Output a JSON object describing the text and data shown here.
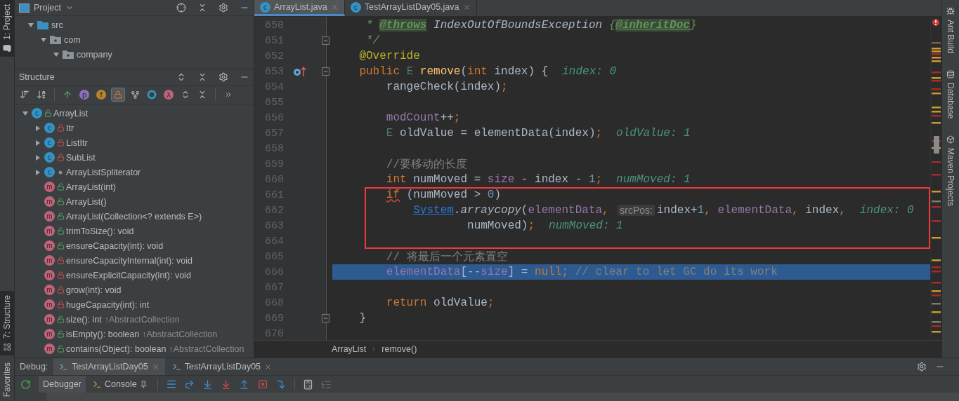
{
  "left_strip": {
    "top": [
      {
        "label": "1: Project",
        "kind": "project",
        "selected": true
      },
      {
        "label": "7: Structure",
        "kind": "structure",
        "selected": true
      }
    ],
    "bottom": [
      {
        "label": "Favorites",
        "selected": false
      }
    ]
  },
  "project": {
    "title": "Project",
    "tree": [
      {
        "label": "src",
        "kind": "source-folder",
        "expanded": true,
        "children": [
          {
            "label": "com",
            "kind": "package",
            "expanded": true,
            "children": [
              {
                "label": "company",
                "kind": "package",
                "expanded": true
              }
            ]
          }
        ]
      }
    ]
  },
  "structure": {
    "title": "Structure",
    "toolbar_groups": [
      {
        "items": [
          {
            "kind": "sort-visibility",
            "selected": false
          },
          {
            "kind": "sort-alpha",
            "selected": false
          }
        ]
      },
      {
        "items": [
          {
            "kind": "properties",
            "selected": false
          },
          {
            "kind": "glyph",
            "glyph": "p",
            "color": "#8d6fbf",
            "selected": false
          },
          {
            "kind": "glyph",
            "glyph": "f",
            "color": "#b5852e",
            "selected": false
          },
          {
            "kind": "non-public",
            "selected": true
          },
          {
            "kind": "anonymous",
            "selected": false
          },
          {
            "kind": "ring",
            "selected": false
          },
          {
            "kind": "glyph",
            "glyph": "λ",
            "color": "#c0637a",
            "selected": false
          },
          {
            "kind": "expand",
            "selected": false
          },
          {
            "kind": "collapse",
            "selected": false
          }
        ]
      },
      {
        "items": [
          {
            "kind": "more",
            "selected": false
          }
        ]
      }
    ],
    "items": [
      {
        "label": "ArrayList",
        "badge": "c",
        "kind": "public",
        "expanded": true,
        "children": [
          {
            "label": "Itr",
            "badge": "c",
            "kind": "private",
            "expanded": false
          },
          {
            "label": "ListItr",
            "badge": "c",
            "kind": "private",
            "expanded": false
          },
          {
            "label": "SubList",
            "badge": "c",
            "kind": "private",
            "expanded": false
          },
          {
            "label": "ArrayListSpliterator",
            "badge": "c",
            "kind": "package",
            "expanded": false
          },
          {
            "label": "ArrayList(int)",
            "badge": "m",
            "kind": "public"
          },
          {
            "label": "ArrayList()",
            "badge": "m",
            "kind": "public"
          },
          {
            "label": "ArrayList(Collection<? extends E>)",
            "badge": "m",
            "kind": "public"
          },
          {
            "label": "trimToSize(): void",
            "badge": "m",
            "kind": "public"
          },
          {
            "label": "ensureCapacity(int): void",
            "badge": "m",
            "kind": "public"
          },
          {
            "label": "ensureCapacityInternal(int): void",
            "badge": "m",
            "kind": "private"
          },
          {
            "label": "ensureExplicitCapacity(int): void",
            "badge": "m",
            "kind": "private"
          },
          {
            "label": "grow(int): void",
            "badge": "m",
            "kind": "private"
          },
          {
            "label": "hugeCapacity(int): int",
            "badge": "m",
            "kind": "private"
          },
          {
            "label": "size(): int",
            "origin": "↑AbstractCollection",
            "badge": "m",
            "kind": "public"
          },
          {
            "label": "isEmpty(): boolean",
            "origin": "↑AbstractCollection",
            "badge": "m",
            "kind": "public"
          },
          {
            "label": "contains(Object): boolean",
            "origin": "↑AbstractCollection",
            "badge": "m",
            "kind": "public"
          }
        ]
      }
    ]
  },
  "editor": {
    "tabs": [
      {
        "label": "ArrayList.java",
        "badge": "c",
        "selected": true
      },
      {
        "label": "TestArrayListDay05.java",
        "badge": "c",
        "selected": false
      }
    ],
    "lines": [
      {
        "number": "650",
        "tokens": [
          {
            "text": "     * ",
            "kind": "doc"
          },
          {
            "text": "@throws",
            "kind": "doc-tag"
          },
          {
            "text": " IndexOutOfBoundsException ",
            "kind": "doc-value"
          },
          {
            "text": "{",
            "kind": "doc"
          },
          {
            "text": "@inheritDoc",
            "kind": "doc-tag"
          },
          {
            "text": "}",
            "kind": "doc"
          }
        ]
      },
      {
        "number": "651",
        "fold": true,
        "tokens": [
          {
            "text": "     */",
            "kind": "doc"
          }
        ]
      },
      {
        "number": "652",
        "tokens": [
          {
            "text": "    @Override",
            "kind": "annotation"
          }
        ]
      },
      {
        "number": "653",
        "overridden": true,
        "fold": true,
        "tokens": [
          {
            "text": "    public ",
            "kind": "keyword"
          },
          {
            "text": "E ",
            "kind": "type"
          },
          {
            "text": "remove",
            "kind": "method-decl"
          },
          {
            "text": "(",
            "kind": "plain"
          },
          {
            "text": "int ",
            "kind": "keyword"
          },
          {
            "text": "index) {",
            "kind": "plain"
          }
        ],
        "hint": "index: 0"
      },
      {
        "number": "654",
        "tokens": [
          {
            "text": "        rangeCheck(index)",
            "kind": "plain"
          },
          {
            "text": ";",
            "kind": "keyword"
          }
        ]
      },
      {
        "number": "655"
      },
      {
        "number": "656",
        "tokens": [
          {
            "text": "        modCount",
            "kind": "field"
          },
          {
            "text": "++",
            "kind": "plain"
          },
          {
            "text": ";",
            "kind": "keyword"
          }
        ]
      },
      {
        "number": "657",
        "tokens": [
          {
            "text": "        E",
            "kind": "type"
          },
          {
            "text": " oldValue = elementData(index)",
            "kind": "plain"
          },
          {
            "text": ";",
            "kind": "keyword"
          }
        ],
        "hint": "oldValue: 1"
      },
      {
        "number": "658"
      },
      {
        "number": "659",
        "tokens": [
          {
            "text": "        //要移动的长度",
            "kind": "comment"
          }
        ]
      },
      {
        "number": "660",
        "tokens": [
          {
            "text": "        int ",
            "kind": "keyword"
          },
          {
            "text": "numMoved = ",
            "kind": "plain"
          },
          {
            "text": "size",
            "kind": "field"
          },
          {
            "text": " - index - ",
            "kind": "plain"
          },
          {
            "text": "1",
            "kind": "number"
          },
          {
            "text": ";",
            "kind": "keyword"
          }
        ],
        "hint": "numMoved: 1"
      },
      {
        "number": "661",
        "boxed": true,
        "tokens": [
          {
            "text": "        if",
            "kind": "keyword",
            "squiggle": true
          },
          {
            "text": " (numMoved > ",
            "kind": "plain"
          },
          {
            "text": "0",
            "kind": "number"
          },
          {
            "text": ")",
            "kind": "plain"
          }
        ]
      },
      {
        "number": "662",
        "boxed": true,
        "tokens": [
          {
            "text": "            System",
            "kind": "class-ref"
          },
          {
            "text": ".",
            "kind": "plain"
          },
          {
            "text": "arraycopy",
            "kind": "static-method"
          },
          {
            "text": "(",
            "kind": "plain"
          },
          {
            "text": "elementData",
            "kind": "field"
          },
          {
            "text": ", ",
            "kind": "keyword"
          },
          {
            "text": "srcPos:",
            "kind": "param-hint"
          },
          {
            "text": "index+",
            "kind": "plain"
          },
          {
            "text": "1",
            "kind": "number"
          },
          {
            "text": ", ",
            "kind": "keyword"
          },
          {
            "text": "elementData",
            "kind": "field"
          },
          {
            "text": ", ",
            "kind": "keyword"
          },
          {
            "text": "index",
            "kind": "plain"
          },
          {
            "text": ",",
            "kind": "keyword"
          }
        ],
        "hint": "index: 0"
      },
      {
        "number": "663",
        "boxed": true,
        "tokens": [
          {
            "text": "                    numMoved)",
            "kind": "plain"
          },
          {
            "text": ";",
            "kind": "keyword"
          }
        ],
        "hint": "numMoved: 1"
      },
      {
        "number": "664",
        "boxed": true
      },
      {
        "number": "665",
        "tokens": [
          {
            "text": "        // 将最后一个元素置空",
            "kind": "comment"
          }
        ]
      },
      {
        "number": "666",
        "executing": true,
        "tokens": [
          {
            "text": "        elementData",
            "kind": "field"
          },
          {
            "text": "[--",
            "kind": "plain"
          },
          {
            "text": "size",
            "kind": "field"
          },
          {
            "text": "] = ",
            "kind": "plain"
          },
          {
            "text": "null",
            "kind": "keyword"
          },
          {
            "text": ";",
            "kind": "keyword"
          },
          {
            "text": " // clear to let GC do its work",
            "kind": "comment"
          }
        ]
      },
      {
        "number": "667"
      },
      {
        "number": "668",
        "tokens": [
          {
            "text": "        return ",
            "kind": "keyword"
          },
          {
            "text": "oldValue",
            "kind": "plain"
          },
          {
            "text": ";",
            "kind": "keyword"
          }
        ]
      },
      {
        "number": "669",
        "fold": true,
        "tokens": [
          {
            "text": "    }",
            "kind": "plain"
          }
        ]
      },
      {
        "number": "670"
      }
    ],
    "breadcrumb": [
      "ArrayList",
      "remove()"
    ]
  },
  "right_strip": [
    {
      "label": "Ant Build",
      "kind": "ant"
    },
    {
      "label": "Database",
      "kind": "database"
    },
    {
      "label": "Maven Projects",
      "kind": "maven"
    }
  ],
  "debug": {
    "label": "Debug:",
    "sessions": [
      {
        "label": "TestArrayListDay05",
        "selected": true
      },
      {
        "label": "TestArrayListDay05",
        "selected": false
      }
    ],
    "views": [
      {
        "label": "Debugger",
        "kind": "debugger",
        "selected": true
      },
      {
        "label": "Console",
        "kind": "console",
        "selected": false
      }
    ],
    "action_groups": [
      {
        "items": [
          {
            "kind": "execution-point",
            "disabled": false
          },
          {
            "kind": "step-over",
            "disabled": false
          },
          {
            "kind": "step-into",
            "disabled": false
          },
          {
            "kind": "force-step-into",
            "disabled": false
          },
          {
            "kind": "step-out",
            "disabled": false
          },
          {
            "kind": "drop-frame",
            "disabled": false
          },
          {
            "kind": "run-to-cursor",
            "disabled": false
          }
        ]
      },
      {
        "items": [
          {
            "kind": "evaluate",
            "disabled": false
          },
          {
            "kind": "trace",
            "disabled": true
          }
        ]
      }
    ]
  }
}
